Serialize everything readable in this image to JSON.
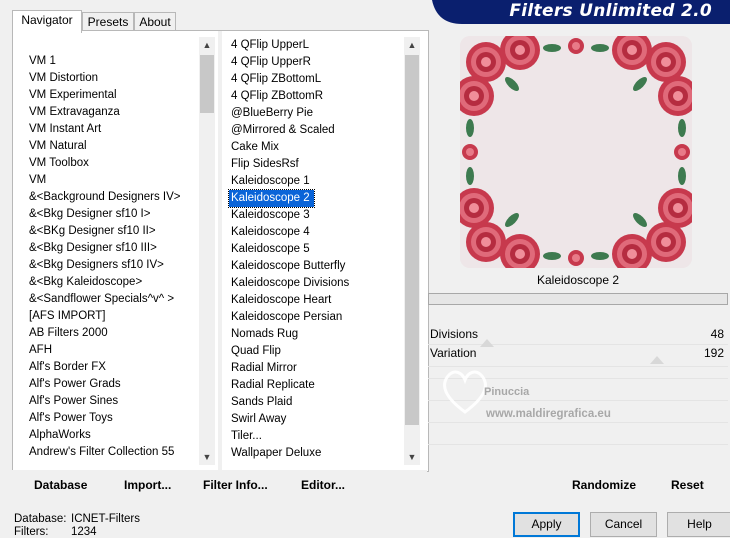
{
  "tabs": [
    "Navigator",
    "Presets",
    "About"
  ],
  "banner": {
    "title": "Filters Unlimited 2.0"
  },
  "categories": [
    "VM 1",
    "VM Distortion",
    "VM Experimental",
    "VM Extravaganza",
    "VM Instant Art",
    "VM Natural",
    "VM Toolbox",
    "VM",
    "&<Background Designers IV>",
    "&<Bkg Designer sf10 I>",
    "&<BKg Designer sf10 II>",
    "&<Bkg Designer sf10 III>",
    "&<Bkg Designers sf10 IV>",
    "&<Bkg Kaleidoscope>",
    "&<Sandflower Specials^v^ >",
    "[AFS IMPORT]",
    "AB Filters 2000",
    "AFH",
    "Alf's Border FX",
    "Alf's Power Grads",
    "Alf's Power Sines",
    "Alf's Power Toys",
    "AlphaWorks",
    "Andrew's Filter Collection 55"
  ],
  "filters": [
    "4 QFlip UpperL",
    "4 QFlip UpperR",
    "4 QFlip ZBottomL",
    "4 QFlip ZBottomR",
    "@BlueBerry Pie",
    "@Mirrored & Scaled",
    "Cake Mix",
    "Flip SidesRsf",
    "Kaleidoscope 1",
    "Kaleidoscope 2",
    "Kaleidoscope 3",
    "Kaleidoscope 4",
    "Kaleidoscope 5",
    "Kaleidoscope Butterfly",
    "Kaleidoscope Divisions",
    "Kaleidoscope Heart",
    "Kaleidoscope Persian",
    "Nomads Rug",
    "Quad Flip",
    "Radial Mirror",
    "Radial Replicate",
    "Sands Plaid",
    "Swirl Away",
    "Tiler...",
    "Wallpaper Deluxe"
  ],
  "selected_filter": "Kaleidoscope 2",
  "bottom_links": {
    "database": "Database",
    "import": "Import...",
    "filter_info": "Filter Info...",
    "editor": "Editor..."
  },
  "preview": {
    "filter_name": "Kaleidoscope 2",
    "watermark_top": "Pinuccia",
    "watermark_bottom": "www.maldiregrafica.eu"
  },
  "params": [
    {
      "name": "Divisions",
      "value": "48",
      "level": 0.19
    },
    {
      "name": "Variation",
      "value": "192",
      "level": 0.75
    }
  ],
  "randomize": "Randomize",
  "reset": "Reset",
  "status": {
    "db_label": "Database:",
    "db_value": "ICNET-Filters",
    "filters_label": "Filters:",
    "filters_value": "1234"
  },
  "buttons": {
    "apply": "Apply",
    "cancel": "Cancel",
    "help": "Help"
  },
  "colors": {
    "selection": "#0a64d8",
    "banner": "#0a1f6e",
    "rose": "#d0485a"
  }
}
